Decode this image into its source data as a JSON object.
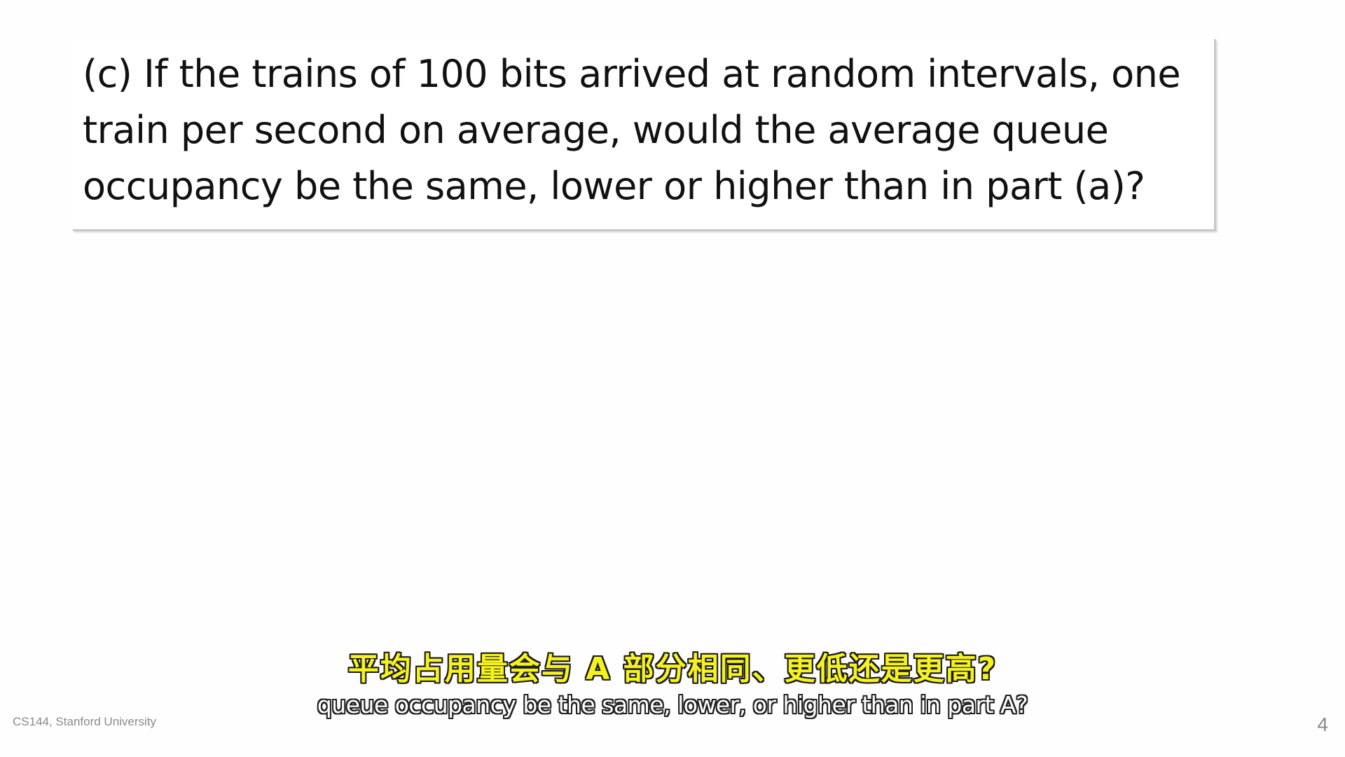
{
  "slide": {
    "question": "(c) If the trains of 100 bits arrived at random intervals, one train per second on average, would the average queue occupancy be the same, lower or higher than in part (a)?",
    "footer": "CS144, Stanford University",
    "page_number": "4"
  },
  "subtitles": {
    "chinese": "平均占用量会与 A 部分相同、更低还是更高?",
    "english": "queue occupancy be the same, lower, or higher than in part A?"
  },
  "colors": {
    "subtitle_cn": "#f5f21e",
    "subtitle_en": "#ffffff",
    "footer": "#8a8a8a"
  }
}
